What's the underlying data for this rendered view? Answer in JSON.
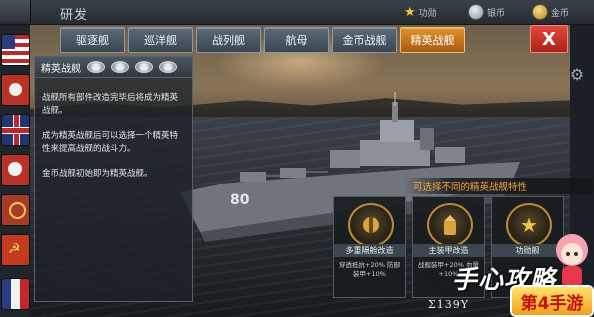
{
  "topbar": {
    "title": "研发",
    "resources": [
      {
        "icon": "star-icon",
        "label": "功勋"
      },
      {
        "icon": "coin-icon",
        "label": "银币"
      },
      {
        "icon": "gold-icon",
        "label": "金币"
      }
    ]
  },
  "tabs": [
    {
      "label": "驱逐舰",
      "active": false
    },
    {
      "label": "巡洋舰",
      "active": false
    },
    {
      "label": "战列舰",
      "active": false
    },
    {
      "label": "航母",
      "active": false
    },
    {
      "label": "金币战舰",
      "active": false
    },
    {
      "label": "精英战舰",
      "active": true
    }
  ],
  "close_label": "X",
  "info_panel": {
    "header": "精英战舰",
    "paragraphs": [
      "战舰所有部件改造完毕后将成为精英战舰。",
      "成为精英战舰后可以选择一个精英特性来提高战舰的战斗力。",
      "金币战舰初始即为精英战舰。"
    ]
  },
  "elite_banner": "可选择不同的精英战舰特性",
  "features": [
    {
      "label": "多重隔舱改造",
      "icon": "bulkhead-icon",
      "desc": "穿透抵抗+20% 防御装甲+10%"
    },
    {
      "label": "主装甲改造",
      "icon": "armor-shell-icon",
      "desc": "战舰装甲+20% 血量+10%"
    },
    {
      "label": "功勋舰",
      "icon": "merit-star-icon",
      "desc": ""
    }
  ],
  "coordinate": "Σ139Y",
  "watermark": {
    "text": "手心攻略",
    "badge": "第4手游"
  },
  "colors": {
    "active_tab": "#e0922e",
    "close": "#e2483b",
    "banner_text": "#f2a43a"
  }
}
